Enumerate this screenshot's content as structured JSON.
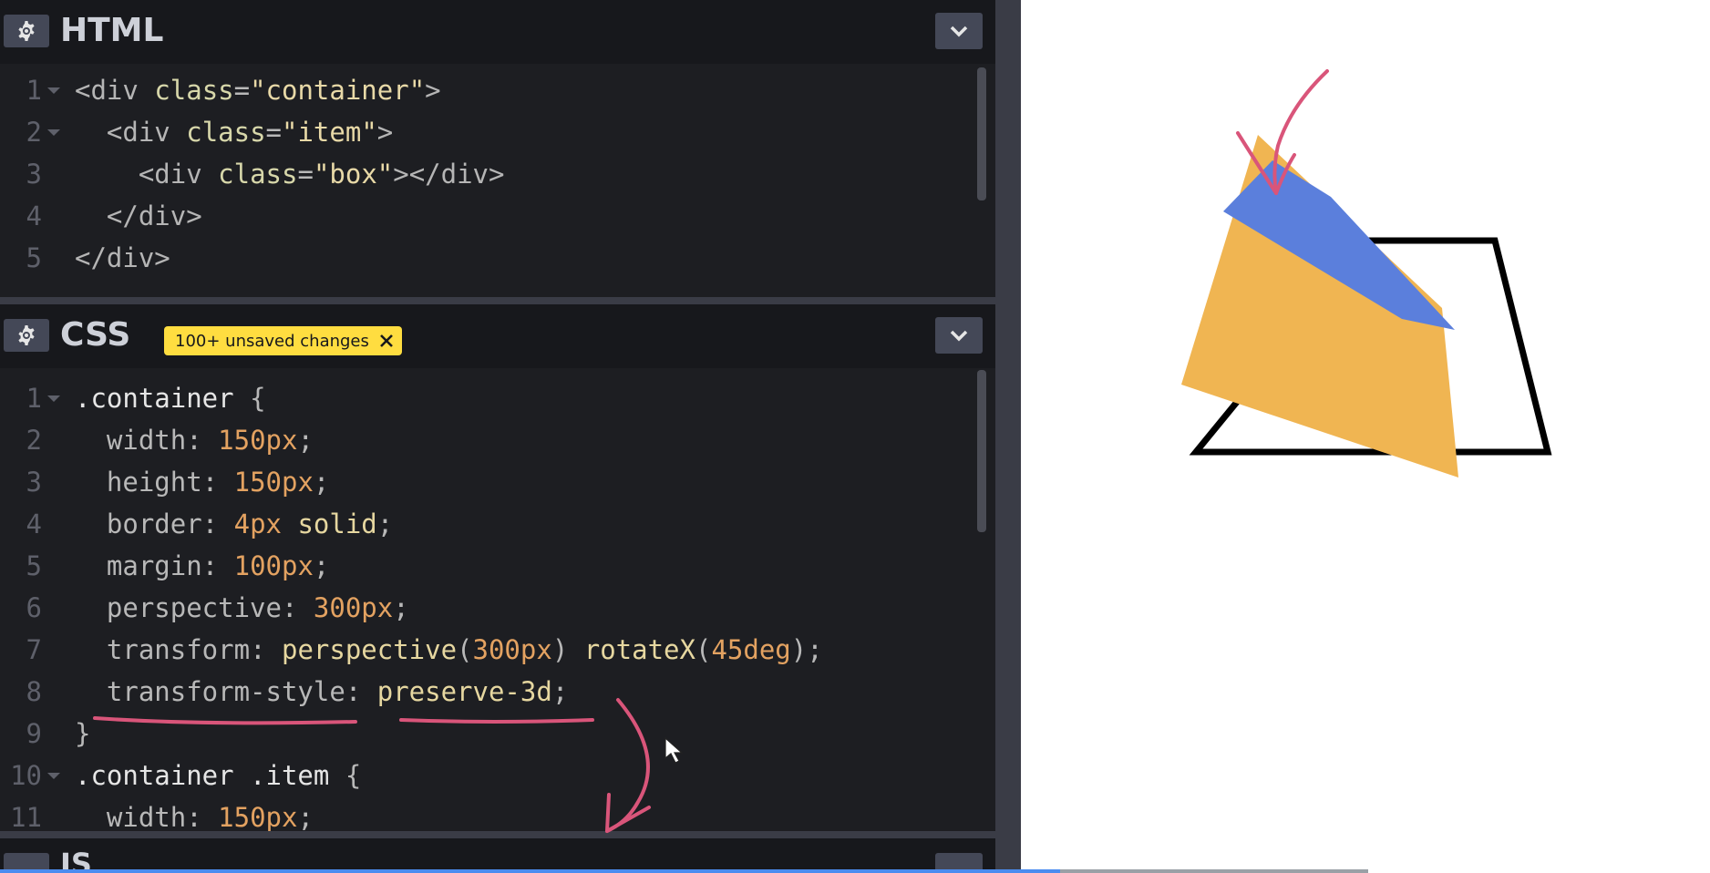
{
  "html_panel": {
    "title": "HTML",
    "lines": [
      {
        "num": "1",
        "indent": "",
        "fold": true,
        "tokens": [
          [
            "t",
            "<div "
          ],
          [
            "a",
            "class"
          ],
          [
            "p",
            "="
          ],
          [
            "s",
            "\"container\""
          ],
          [
            "t",
            ">"
          ]
        ]
      },
      {
        "num": "2",
        "indent": "  ",
        "fold": true,
        "tokens": [
          [
            "t",
            "<div "
          ],
          [
            "a",
            "class"
          ],
          [
            "p",
            "="
          ],
          [
            "s",
            "\"item\""
          ],
          [
            "t",
            ">"
          ]
        ]
      },
      {
        "num": "3",
        "indent": "    ",
        "fold": false,
        "tokens": [
          [
            "t",
            "<div "
          ],
          [
            "a",
            "class"
          ],
          [
            "p",
            "="
          ],
          [
            "s",
            "\"box\""
          ],
          [
            "t",
            "></div>"
          ]
        ]
      },
      {
        "num": "4",
        "indent": "  ",
        "fold": false,
        "tokens": [
          [
            "t",
            "</div>"
          ]
        ]
      },
      {
        "num": "5",
        "indent": "",
        "fold": false,
        "tokens": [
          [
            "t",
            "</div>"
          ]
        ]
      }
    ]
  },
  "css_panel": {
    "title": "CSS",
    "badge": "100+ unsaved changes",
    "lines": [
      {
        "num": "1",
        "indent": "",
        "fold": true,
        "tokens": [
          [
            "sel",
            ".container "
          ],
          [
            "p",
            "{"
          ]
        ]
      },
      {
        "num": "2",
        "indent": "  ",
        "fold": false,
        "tokens": [
          [
            "p",
            "width"
          ],
          [
            "p",
            ": "
          ],
          [
            "n",
            "150px"
          ],
          [
            "p",
            ";"
          ]
        ]
      },
      {
        "num": "3",
        "indent": "  ",
        "fold": false,
        "tokens": [
          [
            "p",
            "height"
          ],
          [
            "p",
            ": "
          ],
          [
            "n",
            "150px"
          ],
          [
            "p",
            ";"
          ]
        ]
      },
      {
        "num": "4",
        "indent": "  ",
        "fold": false,
        "tokens": [
          [
            "p",
            "border"
          ],
          [
            "p",
            ": "
          ],
          [
            "n",
            "4px"
          ],
          [
            "f",
            " solid"
          ],
          [
            "p",
            ";"
          ]
        ]
      },
      {
        "num": "5",
        "indent": "  ",
        "fold": false,
        "tokens": [
          [
            "p",
            "margin"
          ],
          [
            "p",
            ": "
          ],
          [
            "n",
            "100px"
          ],
          [
            "p",
            ";"
          ]
        ]
      },
      {
        "num": "6",
        "indent": "  ",
        "fold": false,
        "tokens": [
          [
            "p",
            "perspective"
          ],
          [
            "p",
            ": "
          ],
          [
            "n",
            "300px"
          ],
          [
            "p",
            ";"
          ]
        ]
      },
      {
        "num": "7",
        "indent": "  ",
        "fold": false,
        "tokens": [
          [
            "p",
            "transform"
          ],
          [
            "p",
            ": "
          ],
          [
            "f",
            "perspective"
          ],
          [
            "p",
            "("
          ],
          [
            "n",
            "300px"
          ],
          [
            "p",
            ") "
          ],
          [
            "f",
            "rotateX"
          ],
          [
            "p",
            "("
          ],
          [
            "n",
            "45deg"
          ],
          [
            "p",
            ");"
          ]
        ]
      },
      {
        "num": "8",
        "indent": "  ",
        "fold": false,
        "tokens": [
          [
            "p",
            "transform-style"
          ],
          [
            "p",
            ": "
          ],
          [
            "f",
            "preserve-3d"
          ],
          [
            "p",
            ";"
          ]
        ]
      },
      {
        "num": "9",
        "indent": "",
        "fold": false,
        "tokens": [
          [
            "p",
            "}"
          ]
        ]
      },
      {
        "num": "10",
        "indent": "",
        "fold": true,
        "tokens": [
          [
            "sel",
            ".container .item "
          ],
          [
            "p",
            "{"
          ]
        ]
      },
      {
        "num": "11",
        "indent": "  ",
        "fold": false,
        "tokens": [
          [
            "p",
            "width"
          ],
          [
            "p",
            ": "
          ],
          [
            "n",
            "150px"
          ],
          [
            "p",
            ";"
          ]
        ]
      }
    ]
  },
  "js_panel": {
    "title": "JS"
  },
  "icons": {
    "settings": "gear-icon",
    "collapse": "chevron-down-icon",
    "badge_close": "close-icon"
  },
  "colors": {
    "editor_bg": "#1d1e22",
    "header_bg": "#17181c",
    "badge_bg": "#ffdd40",
    "annotation": "#d9557a",
    "orange_plane": "#f0b552",
    "blue_plane": "#5b7fdc",
    "progress": "#4b8cf0"
  },
  "video_progress": 0.62
}
